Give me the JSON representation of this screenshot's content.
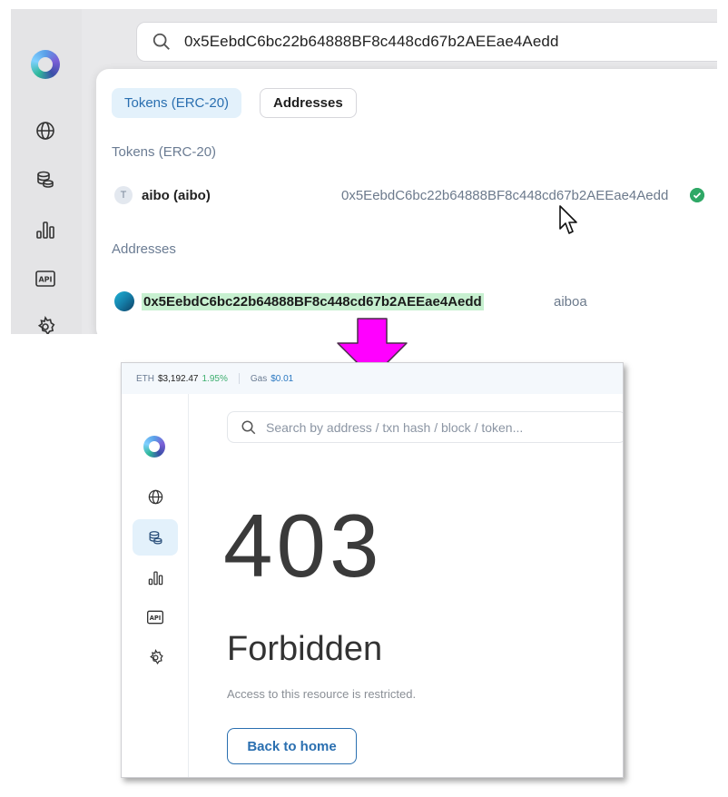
{
  "before": {
    "search": {
      "query": "0x5EebdC6bc22b64888BF8c448cd67b2AEEae4Aedd"
    },
    "dropdown": {
      "tabs": [
        {
          "label": "Tokens (ERC-20)",
          "active": true
        },
        {
          "label": "Addresses",
          "active": false
        }
      ],
      "tokens_section": {
        "title": "Tokens (ERC-20)",
        "item": {
          "badge": "T",
          "name": "aibo (aibo)",
          "address": "0x5EebdC6bc22b64888BF8c448cd67b2AEEae4Aedd",
          "verified": true
        }
      },
      "addresses_section": {
        "title": "Addresses",
        "item": {
          "address": "0x5EebdC6bc22b64888BF8c448cd67b2AEEae4Aedd",
          "label": "aiboa"
        }
      }
    },
    "sidebar_icons": [
      "globe-icon",
      "coins-icon",
      "chart-icon",
      "api-icon",
      "gear-icon"
    ]
  },
  "arrow": {
    "color": "#ff00ff",
    "direction": "down"
  },
  "after": {
    "ticker": {
      "eth_label": "ETH",
      "eth_price": "$3,192.47",
      "eth_change": "1.95%",
      "gas_label": "Gas",
      "gas_price": "$0.01"
    },
    "search": {
      "placeholder": "Search by address / txn hash / block / token..."
    },
    "sidebar_icons": [
      "globe-icon",
      "coins-icon",
      "chart-icon",
      "api-icon",
      "gear-icon"
    ],
    "sidebar_active": "coins-icon",
    "error": {
      "code": "403",
      "title": "Forbidden",
      "message": "Access to this resource is restricted.",
      "button": "Back to home"
    }
  },
  "colors": {
    "accent": "#2a6fb0",
    "positive": "#3cae6e",
    "highlight": "#c7f0d0",
    "arrow": "#ff00ff"
  }
}
